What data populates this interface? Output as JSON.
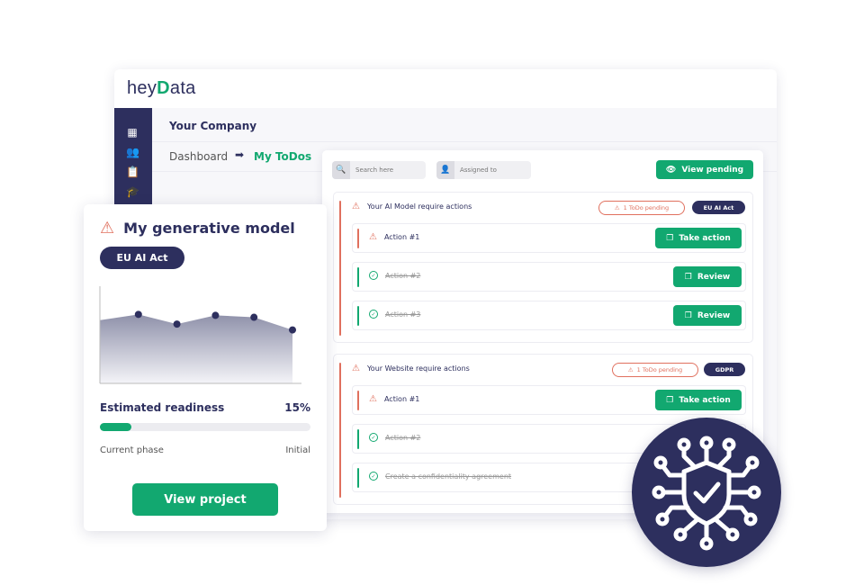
{
  "app": {
    "logo_text_left": "hey",
    "logo_text_mark": "D",
    "logo_text_right": "ata",
    "logo_full": "heyData"
  },
  "header": {
    "company": "Your Company"
  },
  "breadcrumb": {
    "parent": "Dashboard",
    "current": "My ToDos"
  },
  "sidebar": {
    "icons": [
      "dashboard-icon",
      "users-icon",
      "clipboard-icon",
      "graduation-cap-icon"
    ]
  },
  "toolbar": {
    "search_placeholder": "Search here",
    "assigned_placeholder": "Assigned to",
    "view_pending": "View pending"
  },
  "groups": [
    {
      "title": "Your AI Model require actions",
      "pending": "1 ToDo pending",
      "tag": "EU AI Act",
      "rows": [
        {
          "label": "Action #1",
          "done": false,
          "button": "Take action"
        },
        {
          "label": "Action #2",
          "done": true,
          "button": "Review"
        },
        {
          "label": "Action #3",
          "done": true,
          "button": "Review"
        }
      ]
    },
    {
      "title": "Your Website require actions",
      "pending": "1 ToDo pending",
      "tag": "GDPR",
      "rows": [
        {
          "label": "Action #1",
          "done": false,
          "button": "Take action"
        },
        {
          "label": "Action #2",
          "done": true,
          "button": ""
        },
        {
          "label": "Create a confidentiality agreement",
          "done": true,
          "button": ""
        }
      ]
    }
  ],
  "card": {
    "title": "My generative model",
    "tag": "EU AI Act",
    "readiness_label": "Estimated readiness",
    "readiness_value": "15%",
    "readiness_percent": 15,
    "phase_label": "Current phase",
    "phase_value": "Initial",
    "button": "View project",
    "sparkline": [
      65,
      71,
      61,
      70,
      68,
      55
    ]
  },
  "colors": {
    "navy": "#2d2f5e",
    "green": "#12a870",
    "red": "#e0705e"
  }
}
